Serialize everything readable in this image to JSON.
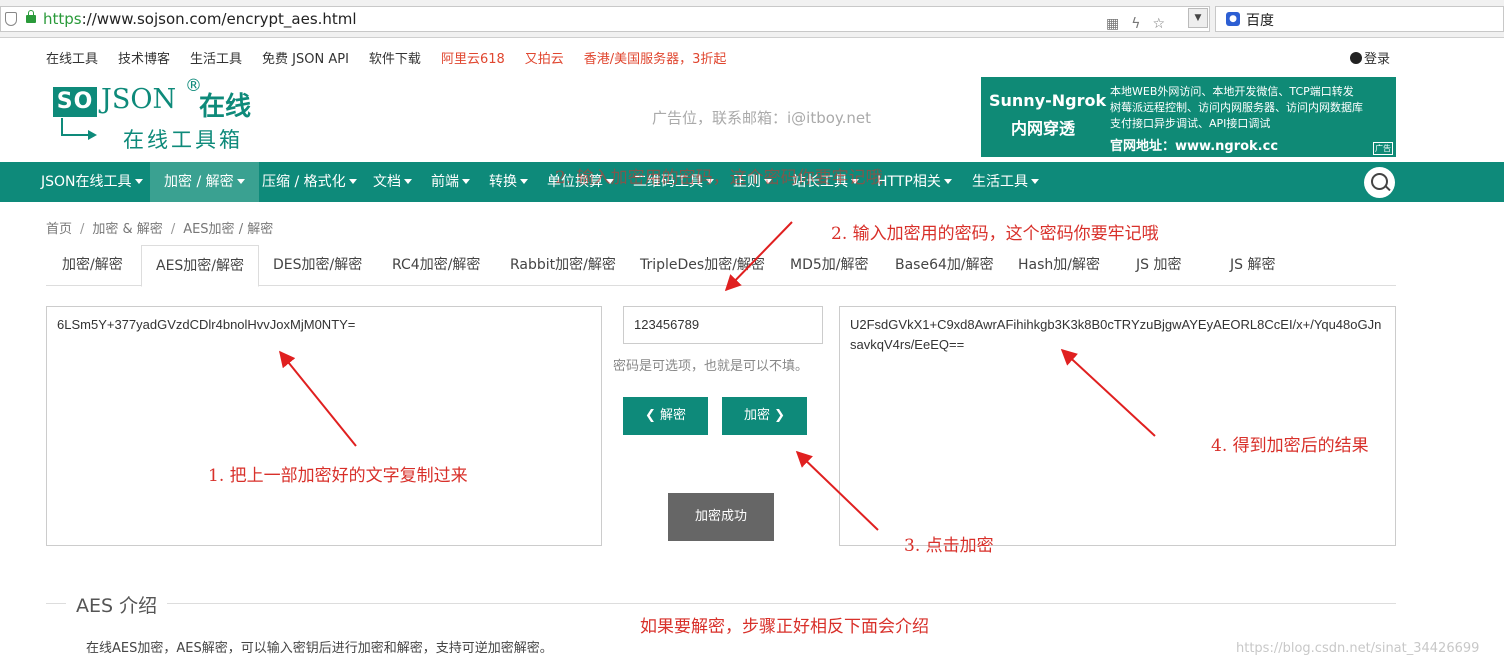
{
  "browser": {
    "url_scheme": "https",
    "url_rest": "://www.sojson.com/encrypt_aes.html",
    "search_engine": "百度"
  },
  "top_links": {
    "items": [
      "在线工具",
      "技术博客",
      "生活工具",
      "免费 JSON API",
      "软件下载"
    ],
    "promo": [
      "阿里云618",
      "又拍云",
      "香港/美国服务器，3折起"
    ],
    "login": "登录"
  },
  "logo": {
    "box": "SO",
    "json": "JSON",
    "reg": "®",
    "online": "在线",
    "sub": "在线工具箱"
  },
  "ad_text": "广告位，联系邮箱：i@itboy.net",
  "banner": {
    "title": "Sunny-Ngrok",
    "subtitle": "内网穿透",
    "line1": "本地WEB外网访问、本地开发微信、TCP端口转发",
    "line2": "树莓派远程控制、访问内网服务器、访问内网数据库",
    "line3": "支付接口异步调试、API接口调试",
    "site": "官网地址：www.ngrok.cc",
    "tag": "广告"
  },
  "nav": {
    "items": [
      "JSON在线工具",
      "加密 / 解密",
      "压缩 / 格式化",
      "文档",
      "前端",
      "转换",
      "单位换算",
      "二维码工具",
      "正则",
      "站长工具",
      "HTTP相关",
      "生活工具"
    ]
  },
  "breadcrumb": [
    "首页",
    "加密 & 解密",
    "AES加密 / 解密"
  ],
  "tabs": [
    "加密/解密",
    "AES加密/解密",
    "DES加密/解密",
    "RC4加密/解密",
    "Rabbit加密/解密",
    "TripleDes加密/解密",
    "MD5加/解密",
    "Base64加/解密",
    "Hash加/解密",
    "JS 加密",
    "JS 解密"
  ],
  "encrypt": {
    "plaintext": "6LSm5Y+377yadGVzdCDlr4bnolHvvJoxMjM0NTY=",
    "password": "123456789",
    "password_hint": "密码是可选项，也就是可以不填。",
    "decrypt_button": "解密",
    "encrypt_button": "加密",
    "status": "加密成功",
    "ciphertext": "U2FsdGVkX1+C9xd8AwrAFihihkgb3K3k8B0cTRYzuBjgwAYEyAEORL8CcEI/x+/Yqu48oGJnsavkqV4rs/EeEQ=="
  },
  "intro": {
    "title": "AES 介绍",
    "text": "在线AES加密，AES解密，可以输入密钥后进行加密和解密，支持可逆加密解密。"
  },
  "watermark": "https://blog.csdn.net/sinat_34426699",
  "annotations": {
    "step1": "1. 把上一部加密好的文字复制过来",
    "step2": "2. 输入加密用的密码，这个密码你要牢记哦",
    "step3": "3. 点击加密",
    "step4": "4. 得到加密后的结果",
    "note": "如果要解密，步骤正好相反下面会介绍"
  },
  "colors": {
    "brand": "#0e8a7a",
    "annotation": "#d8302a"
  }
}
